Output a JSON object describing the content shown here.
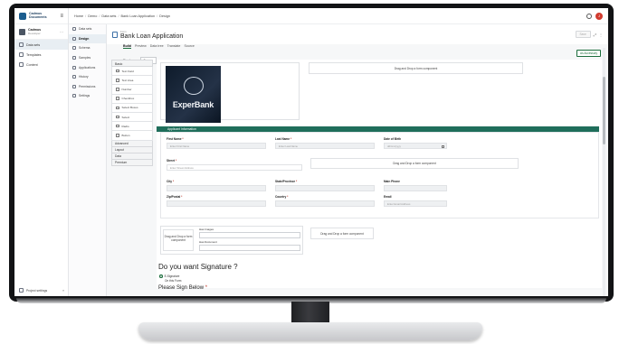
{
  "brand": {
    "name": "Cadmus Documents"
  },
  "workspace": {
    "name": "Cadmus",
    "sub": "Developer"
  },
  "left_nav": {
    "items": [
      {
        "label": "Data sets",
        "active": true
      },
      {
        "label": "Templates",
        "active": false
      },
      {
        "label": "Content",
        "active": false
      }
    ],
    "project_settings": "Project settings"
  },
  "sub_nav": {
    "items": [
      {
        "label": "Data sets",
        "active": false
      },
      {
        "label": "Design",
        "active": true
      },
      {
        "label": "Schema",
        "active": false
      },
      {
        "label": "Samples",
        "active": false
      },
      {
        "label": "Applications",
        "active": false
      },
      {
        "label": "History",
        "active": false
      },
      {
        "label": "Permissions",
        "active": false
      },
      {
        "label": "Settings",
        "active": false
      }
    ]
  },
  "breadcrumb": [
    "Home",
    "Demo",
    "Data sets",
    "Bank Loan Application",
    "Design"
  ],
  "user": {
    "initial": "J"
  },
  "page": {
    "kicker": "Form",
    "title": "Bank Loan Application",
    "save_label": "Save"
  },
  "tabs": [
    "Build",
    "Preview",
    "Data tree",
    "Translate",
    "Source"
  ],
  "display_as": {
    "label": "Display as",
    "value": "Form"
  },
  "wizard_label": "As Accessory",
  "palette": {
    "basic_label": "Basic",
    "basic_items": [
      "Text Field",
      "Text Area",
      "Number",
      "Checkbox",
      "Select Boxes",
      "Select",
      "Radio",
      "Button"
    ],
    "groups": [
      "Advanced",
      "Layout",
      "Data",
      "Premium"
    ]
  },
  "canvas": {
    "logo_text": "ExperBank",
    "logo_sub": "ExperBank",
    "dropzone_text": "Drag and Drop a form component",
    "section_title": "Applicant Information",
    "fields": {
      "first_name": {
        "label": "First Name",
        "placeholder": "Enter First Name"
      },
      "last_name": {
        "label": "Last Name",
        "placeholder": "Enter Last Name"
      },
      "dob": {
        "label": "Date of Birth",
        "placeholder": "dd/mm/yyyy"
      },
      "street": {
        "label": "Street",
        "placeholder": "Enter Street Address"
      },
      "city": {
        "label": "City",
        "placeholder": ""
      },
      "state": {
        "label": "State/Province",
        "placeholder": ""
      },
      "main_phone": {
        "label": "Main Phone",
        "placeholder": ""
      },
      "zip": {
        "label": "Zip/Postal",
        "placeholder": ""
      },
      "country": {
        "label": "Country",
        "placeholder": ""
      },
      "email": {
        "label": "Email",
        "placeholder": "Enter Email Address"
      }
    },
    "upload": {
      "dropzone_text": "Drag and Drop a form component",
      "images_label": "Has Images",
      "document_label": "Has Document"
    },
    "signature_question": "Do you want Signature ?",
    "signature_options": [
      "E-Signature",
      "On this Form"
    ],
    "sign_below": "Please Sign Below"
  },
  "colors": {
    "accent": "#1f6e5b",
    "brand": "#1b5d8f",
    "required": "#c0392b"
  }
}
